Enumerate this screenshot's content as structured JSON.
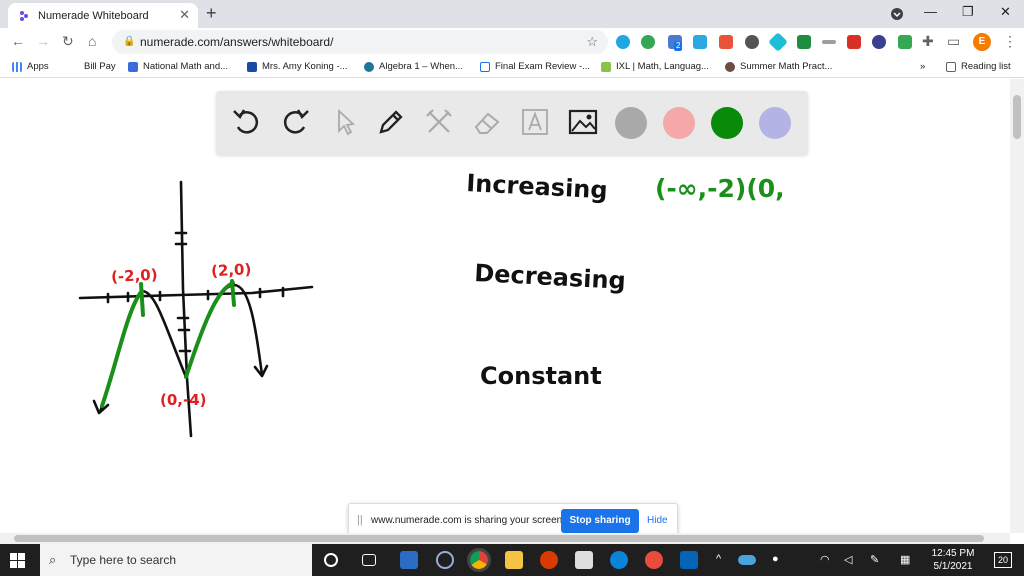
{
  "browser": {
    "tab_title": "Numerade Whiteboard",
    "tab_close": "✕",
    "new_tab": "+",
    "url": "numerade.com/answers/whiteboard/",
    "profile_initial": "E",
    "ext_badge": "2",
    "window_controls": {
      "minimize": "—",
      "restore": "❐",
      "close": "✕"
    }
  },
  "bookmarks": {
    "items": [
      "Apps",
      "Bill Pay",
      "National Math and...",
      "Mrs. Amy Koning -...",
      "Algebra 1 – When...",
      "Final Exam Review -...",
      "IXL | Math, Languag...",
      "Summer Math Pract..."
    ],
    "more": "»",
    "reading_list": "Reading list"
  },
  "whiteboard": {
    "tools": [
      "undo-icon",
      "redo-icon",
      "pointer-icon",
      "pen-icon",
      "tools-icon",
      "eraser-icon",
      "text-icon",
      "image-icon"
    ],
    "colors": [
      "#a9a9a9",
      "#f4a9a8",
      "#0a8a0a",
      "#b3b3e6"
    ],
    "handwriting": {
      "label_1": "(-2,0)",
      "label_2": "(2,0)",
      "label_3": "(0,-4)",
      "increasing": "Increasing",
      "increasing_interval": "(-∞,-2)(0,",
      "decreasing": "Decreasing",
      "constant": "Constant"
    }
  },
  "sharing_bar": {
    "message": "www.numerade.com is sharing your screen.",
    "stop_label": "Stop sharing",
    "hide_label": "Hide"
  },
  "taskbar": {
    "search_placeholder": "Type here to search",
    "time": "12:45 PM",
    "date": "5/1/2021",
    "notifications": "20"
  }
}
